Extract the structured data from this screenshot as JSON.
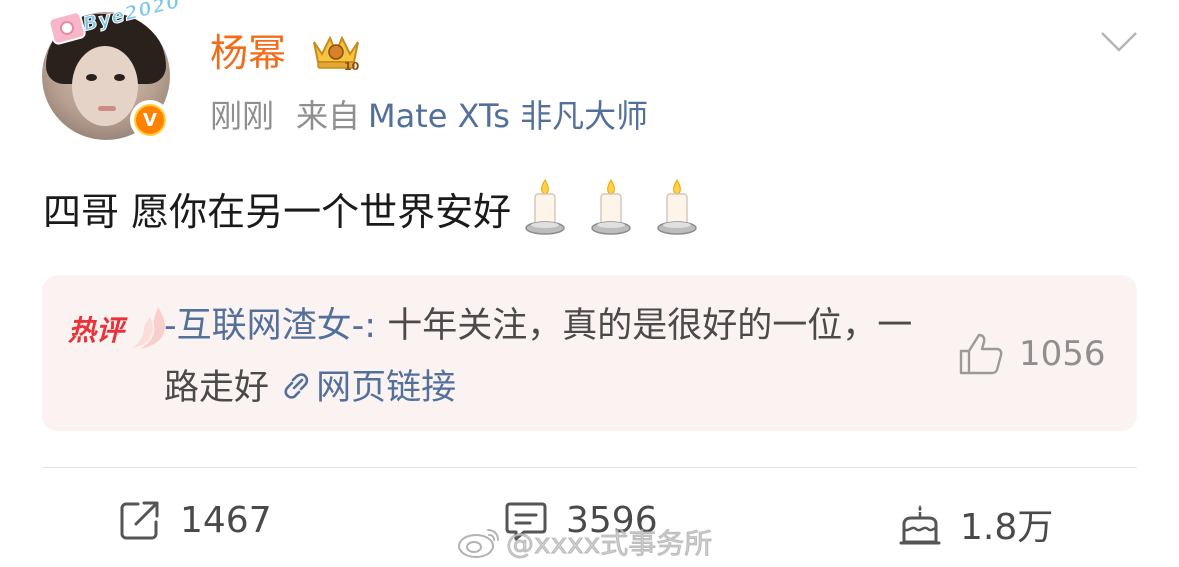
{
  "post": {
    "author": {
      "name": "杨幂",
      "avatar_sticker_text": "Bye2020",
      "verified_badge": "V",
      "vip_badge": "crown-icon"
    },
    "meta": {
      "time": "刚刚",
      "from_label": "来自",
      "source": "Mate XTs 非凡大师"
    },
    "text": "四哥 愿你在另一个世界安好",
    "emoji": [
      "candle-icon",
      "candle-icon",
      "candle-icon"
    ]
  },
  "hot_comment": {
    "tag": "热评",
    "commenter": "-互联网渣女-",
    "separator": ":",
    "line1_text": " 十年关注，真的是很好",
    "line2_text": "的一位，一路走好 ",
    "link_label": "网页链接",
    "like_count": "1056"
  },
  "actions": {
    "repost_count": "1467",
    "comment_count": "3596",
    "like_count": "1.8万"
  },
  "watermark": {
    "text": "@xxxx式事务所"
  },
  "colors": {
    "username": "#f26c1a",
    "link": "#53709b",
    "hot_tag": "#e9323a",
    "card_bg": "#fbf3f1",
    "verified": "#ff8200"
  }
}
